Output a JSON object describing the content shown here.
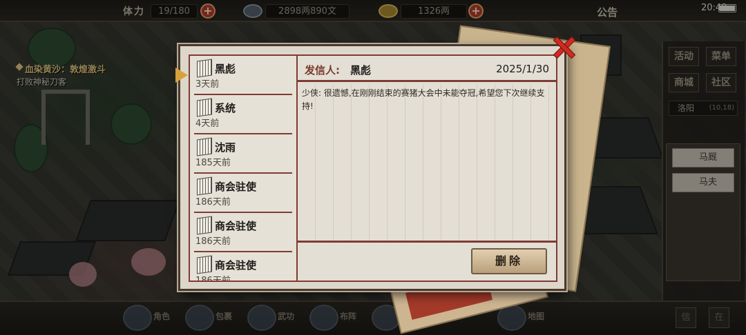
{
  "topbar": {
    "stamina_label": "体力",
    "stamina": "19/180",
    "money": "2898两890文",
    "gold": "1326两",
    "notice": "公告",
    "time": "20:49"
  },
  "quest": {
    "title": "血染黄沙：敦煌激斗",
    "subtitle": "打败神秘刀客"
  },
  "right_panel": {
    "buttons": [
      "活动",
      "菜单",
      "商城",
      "社区"
    ],
    "location": "洛阳",
    "coords": "(10,18)",
    "npcs": [
      "马厩",
      "马夫"
    ]
  },
  "bottombar": {
    "labels": [
      "角色",
      "包裹",
      "武功",
      "布阵",
      "技艺",
      "地图"
    ],
    "corner_buttons": [
      "信",
      "在"
    ]
  },
  "mail": {
    "items": [
      {
        "sender": "黑彪",
        "age": "3天前"
      },
      {
        "sender": "系统",
        "age": "4天前"
      },
      {
        "sender": "沈雨",
        "age": "185天前"
      },
      {
        "sender": "商会驻使",
        "age": "186天前"
      },
      {
        "sender": "商会驻使",
        "age": "186天前"
      },
      {
        "sender": "商会驻使",
        "age": "186天前"
      }
    ],
    "selected": {
      "from_label": "发信人:",
      "from_name": "黑彪",
      "date": "2025/1/30",
      "body": "少侠:    很遗憾,在刚刚结束的赛猪大会中未能夺冠,希望您下次继续支持!"
    },
    "delete_label": "删除"
  }
}
